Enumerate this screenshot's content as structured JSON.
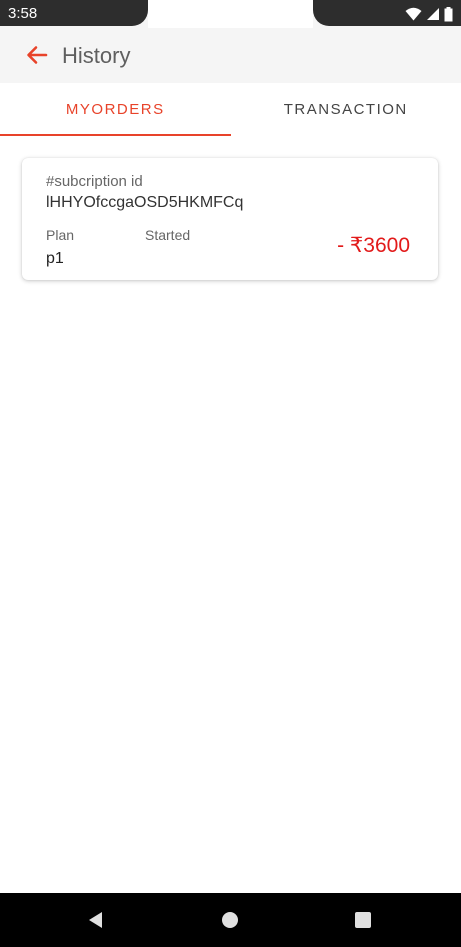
{
  "status_bar": {
    "time": "3:58",
    "icons": [
      "wifi-icon",
      "signal-icon",
      "battery-icon"
    ]
  },
  "app_bar": {
    "title": "History",
    "back_icon": "arrow-left-icon"
  },
  "tabs": [
    {
      "label": "MYORDERS",
      "selected": true
    },
    {
      "label": "TRANSACTION",
      "selected": false
    }
  ],
  "orders": [
    {
      "subscription_label": "#subcription id",
      "subscription_id": "lHHYOfccgaOSD5HKMFCq",
      "plan_label": "Plan",
      "started_label": "Started",
      "plan_value": "p1",
      "amount": "- ₹3600"
    }
  ],
  "nav_bar": {
    "buttons": [
      "back-triangle-icon",
      "home-circle-icon",
      "recents-square-icon"
    ]
  },
  "colors": {
    "accent": "#e8432a",
    "amount": "#e21a1a",
    "app_bar_bg": "#f5f5f5",
    "status_bar_bg": "#2d2d2d",
    "nav_bar_bg": "#000000"
  }
}
